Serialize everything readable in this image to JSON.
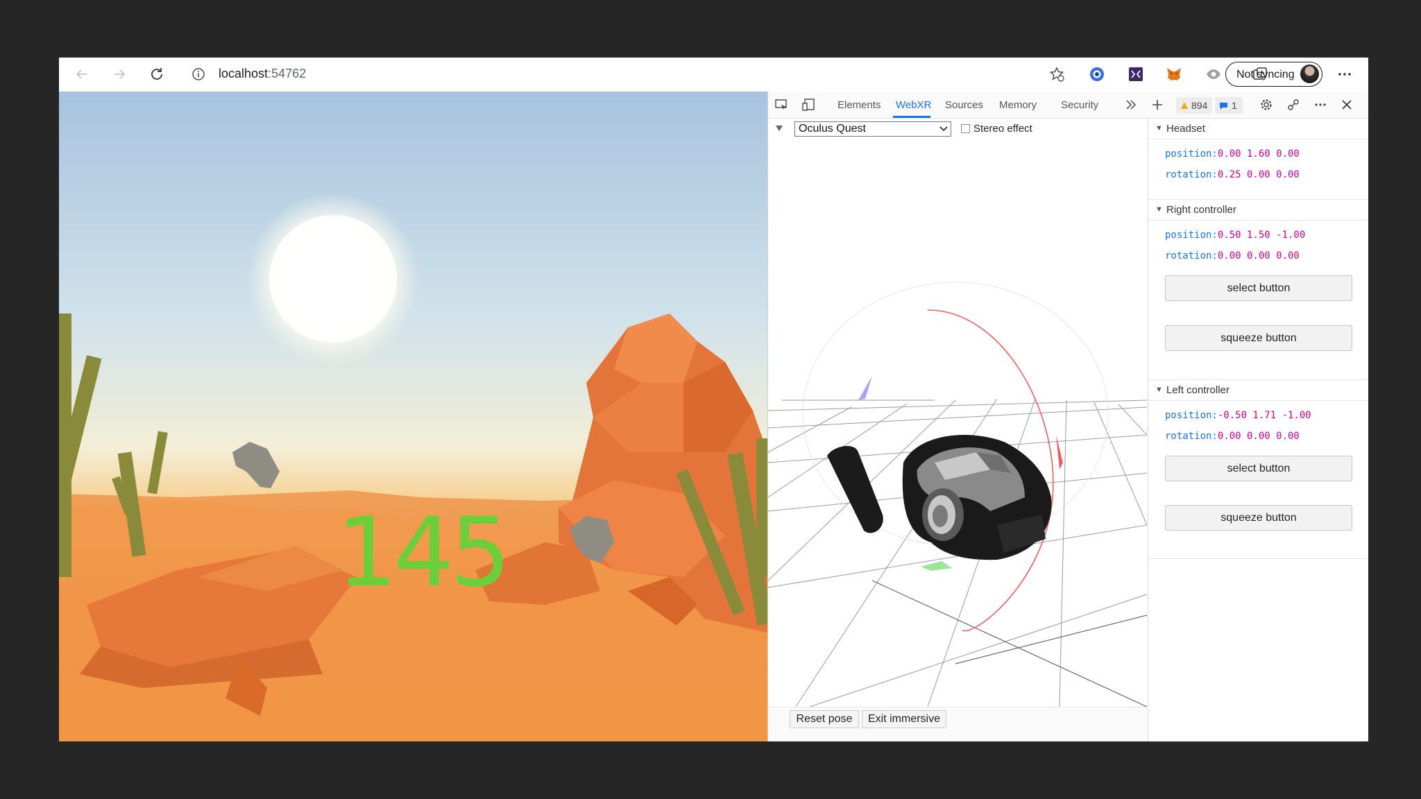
{
  "browser": {
    "url_host": "localhost",
    "url_port": ":54762",
    "sync_label": "Not syncing"
  },
  "scene": {
    "counter": "145",
    "counter_color": "#6ccf3a"
  },
  "devtools": {
    "tabs": [
      "Elements",
      "WebXR",
      "Sources",
      "Memory",
      "Security"
    ],
    "active_tab": "WebXR",
    "warnings_count": "894",
    "info_count": "1",
    "device": "Oculus Quest",
    "stereo_label": "Stereo effect",
    "reset_pose": "Reset pose",
    "exit_immersive": "Exit immersive"
  },
  "panel": {
    "headset": {
      "title": "Headset",
      "position_label": "position:",
      "position_value": "0.00 1.60 0.00",
      "rotation_label": "rotation:",
      "rotation_value": "0.25 0.00 0.00"
    },
    "right_controller": {
      "title": "Right controller",
      "position_label": "position:",
      "position_value": "0.50 1.50 -1.00",
      "rotation_label": "rotation:",
      "rotation_value": "0.00 0.00 0.00",
      "select_label": "select button",
      "squeeze_label": "squeeze button"
    },
    "left_controller": {
      "title": "Left controller",
      "position_label": "position:",
      "position_value": "-0.50 1.71 -1.00",
      "rotation_label": "rotation:",
      "rotation_value": "0.00 0.00 0.00",
      "select_label": "select button",
      "squeeze_label": "squeeze button"
    }
  }
}
